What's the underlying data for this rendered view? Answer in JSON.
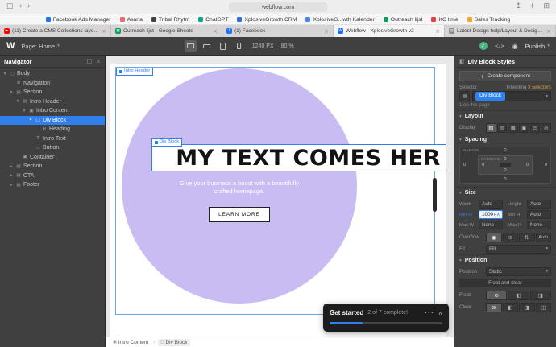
{
  "colors": {
    "accent": "#2f80ed",
    "circle": "#c9bcf2",
    "inherit": "#d79036",
    "green": "#47b881",
    "toast_bg": "#1d1d1d"
  },
  "browser": {
    "toolbar": {
      "url": "webflow.com"
    },
    "favorites": [
      {
        "label": "Facebook Ads Manager",
        "color": "#1877f2"
      },
      {
        "label": "Asana",
        "color": "#f06a6a"
      },
      {
        "label": "Tribal Rhytm",
        "color": "#444444"
      },
      {
        "label": "ChatGPT",
        "color": "#10a37f"
      },
      {
        "label": "XplosiveGrowth CRM",
        "color": "#2d6cdf"
      },
      {
        "label": "XplosiveG...wth Kalender",
        "color": "#4285f4"
      },
      {
        "label": "Outreach lijst",
        "color": "#0f9d58"
      },
      {
        "label": "KC time",
        "color": "#e04040"
      },
      {
        "label": "Sales Tracking",
        "color": "#f4a62a"
      }
    ],
    "tabs": [
      {
        "label": "(11) Create a CMS Collections layout -...",
        "favicon": "youtube-icon",
        "color": "#ff0000",
        "letter": "▶",
        "active": false
      },
      {
        "label": "Outreach lijst - Google Sheets",
        "favicon": "sheets-icon",
        "color": "#0f9d58",
        "letter": "▦",
        "active": false
      },
      {
        "label": "(1) Facebook",
        "favicon": "facebook-icon",
        "color": "#1877f2",
        "letter": "f",
        "active": false
      },
      {
        "label": "Webflow - XplosiveGrowth v2",
        "favicon": "webflow-icon",
        "color": "#146ef5",
        "letter": "W",
        "active": true
      },
      {
        "label": "Latest Design help/Layout & Design top...",
        "favicon": "forum-icon",
        "color": "#8a8a8a",
        "letter": "▤",
        "active": false
      }
    ]
  },
  "designer_toolbar": {
    "logo": "W",
    "page_label": "Page: Home",
    "canvas_width": "1240 PX",
    "zoom": "80 %",
    "publish_label": "Publish"
  },
  "navigator": {
    "title": "Navigator",
    "items": [
      {
        "label": "Body",
        "depth": 0,
        "arrow": "down",
        "icon": "body-icon",
        "selected": false
      },
      {
        "label": "Navigation",
        "depth": 1,
        "arrow": "",
        "icon": "navbar-icon",
        "selected": false
      },
      {
        "label": "Section",
        "depth": 1,
        "arrow": "down",
        "icon": "section-icon",
        "selected": false
      },
      {
        "label": "Intro Header",
        "depth": 2,
        "arrow": "down",
        "icon": "section-icon",
        "selected": false
      },
      {
        "label": "Intro Content",
        "depth": 3,
        "arrow": "down",
        "icon": "container-icon",
        "selected": false
      },
      {
        "label": "Div Block",
        "depth": 4,
        "arrow": "down",
        "icon": "div-icon",
        "selected": true
      },
      {
        "label": "Heading",
        "depth": 5,
        "arrow": "",
        "icon": "heading-icon",
        "selected": false
      },
      {
        "label": "Intro Text",
        "depth": 4,
        "arrow": "",
        "icon": "text-icon",
        "selected": false
      },
      {
        "label": "Button",
        "depth": 4,
        "arrow": "",
        "icon": "button-icon",
        "selected": false
      },
      {
        "label": "Container",
        "depth": 2,
        "arrow": "",
        "icon": "container-icon",
        "selected": false
      },
      {
        "label": "Section",
        "depth": 1,
        "arrow": "right",
        "icon": "section-icon",
        "selected": false
      },
      {
        "label": "CTA",
        "depth": 1,
        "arrow": "right",
        "icon": "section-icon",
        "selected": false
      },
      {
        "label": "Footer",
        "depth": 1,
        "arrow": "right",
        "icon": "section-icon",
        "selected": false
      }
    ]
  },
  "canvas": {
    "section_tag": "Intro Header",
    "element_tag": "Div Block",
    "heading": "MY TEXT COMES HER",
    "subtitle_line1": "Give your business a boost with a beautifully",
    "subtitle_line2": "crafted homepage.",
    "button_label": "LEARN MORE",
    "breadcrumb": [
      {
        "label": "Intro Content",
        "icon": "container-icon"
      },
      {
        "label": "Div Block",
        "icon": "div-icon"
      }
    ]
  },
  "toast": {
    "title": "Get started",
    "status": "2 of 7 complete!",
    "progress_percent": 29
  },
  "style_panel": {
    "title": "Div Block Styles",
    "create_component_label": "Create component",
    "selector": {
      "label": "Selector",
      "value": "Div Block",
      "inheriting_prefix": "Inheriting",
      "inheriting_link": "3 selectors",
      "usage": "1 on this page"
    },
    "layout": {
      "title": "Layout",
      "display_label": "Display",
      "display_options": [
        "block-icon",
        "flex-icon",
        "grid-icon",
        "inline-block-icon",
        "inline-icon",
        "none-icon"
      ]
    },
    "spacing": {
      "title": "Spacing",
      "margin_label": "MARGIN",
      "padding_label": "PADDING",
      "margin": {
        "top": "0",
        "right": "0",
        "bottom": "0",
        "left": "0"
      },
      "padding": {
        "top": "0",
        "right": "0",
        "bottom": "0",
        "left": "0"
      }
    },
    "size": {
      "title": "Size",
      "rows": [
        {
          "label": "Width",
          "value": "Auto"
        },
        {
          "label": "Height",
          "value": "Auto"
        },
        {
          "label": "Min W",
          "value": "1000",
          "unit": "PX"
        },
        {
          "label": "Min H",
          "value": "Auto"
        },
        {
          "label": "Max W",
          "value": "None"
        },
        {
          "label": "Max H",
          "value": "None"
        }
      ],
      "overflow_label": "Overflow",
      "overflow_options": [
        "visible-icon",
        "hidden-icon",
        "scroll-icon"
      ],
      "overflow_auto_label": "Auto",
      "fit_label": "Fit",
      "fit_value": "Fill"
    },
    "position": {
      "title": "Position",
      "position_label": "Position",
      "position_value": "Static",
      "float_clear_label": "Float and clear",
      "float_label": "Float",
      "float_options": [
        "float-none-icon",
        "float-left-icon",
        "float-right-icon"
      ],
      "clear_label": "Clear",
      "clear_options": [
        "clear-none-icon",
        "clear-left-icon",
        "clear-right-icon",
        "clear-both-icon"
      ]
    }
  }
}
